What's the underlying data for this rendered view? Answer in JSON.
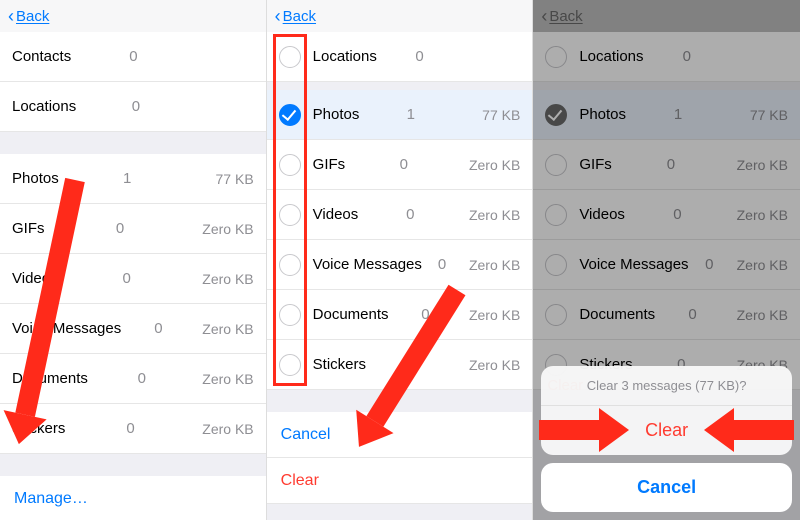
{
  "nav": {
    "back": "Back"
  },
  "panel1": {
    "top": [
      {
        "label": "Contacts",
        "count": "0",
        "size": ""
      },
      {
        "label": "Locations",
        "count": "0",
        "size": ""
      }
    ],
    "media": [
      {
        "label": "Photos",
        "count": "1",
        "size": "77 KB"
      },
      {
        "label": "GIFs",
        "count": "0",
        "size": "Zero KB"
      },
      {
        "label": "Videos",
        "count": "0",
        "size": "Zero KB"
      },
      {
        "label": "Voice Messages",
        "count": "0",
        "size": "Zero KB"
      },
      {
        "label": "Documents",
        "count": "0",
        "size": "Zero KB"
      },
      {
        "label": "Stickers",
        "count": "0",
        "size": "Zero KB"
      }
    ],
    "manage": "Manage…"
  },
  "panel2": {
    "rows": [
      {
        "label": "Locations",
        "count": "0",
        "size": "",
        "checked": false
      },
      {
        "label": "Photos",
        "count": "1",
        "size": "77 KB",
        "checked": true
      },
      {
        "label": "GIFs",
        "count": "0",
        "size": "Zero KB",
        "checked": false
      },
      {
        "label": "Videos",
        "count": "0",
        "size": "Zero KB",
        "checked": false
      },
      {
        "label": "Voice Messages",
        "count": "0",
        "size": "Zero KB",
        "checked": false
      },
      {
        "label": "Documents",
        "count": "0",
        "size": "Zero KB",
        "checked": false
      },
      {
        "label": "Stickers",
        "count": "0",
        "size": "Zero KB",
        "checked": false
      }
    ],
    "cancel": "Cancel",
    "clear": "Clear"
  },
  "panel3": {
    "rows": [
      {
        "label": "Locations",
        "count": "0",
        "size": "",
        "checked": false
      },
      {
        "label": "Photos",
        "count": "1",
        "size": "77 KB",
        "checked": true
      },
      {
        "label": "GIFs",
        "count": "0",
        "size": "Zero KB",
        "checked": false
      },
      {
        "label": "Videos",
        "count": "0",
        "size": "Zero KB",
        "checked": false
      },
      {
        "label": "Voice Messages",
        "count": "0",
        "size": "Zero KB",
        "checked": false
      },
      {
        "label": "Documents",
        "count": "0",
        "size": "Zero KB",
        "checked": false
      },
      {
        "label": "Stickers",
        "count": "0",
        "size": "Zero KB",
        "checked": false
      }
    ],
    "sheet": {
      "message": "Clear 3 messages (77 KB)?",
      "clear": "Clear",
      "cancel": "Cancel"
    },
    "clear_under": "Clear"
  }
}
